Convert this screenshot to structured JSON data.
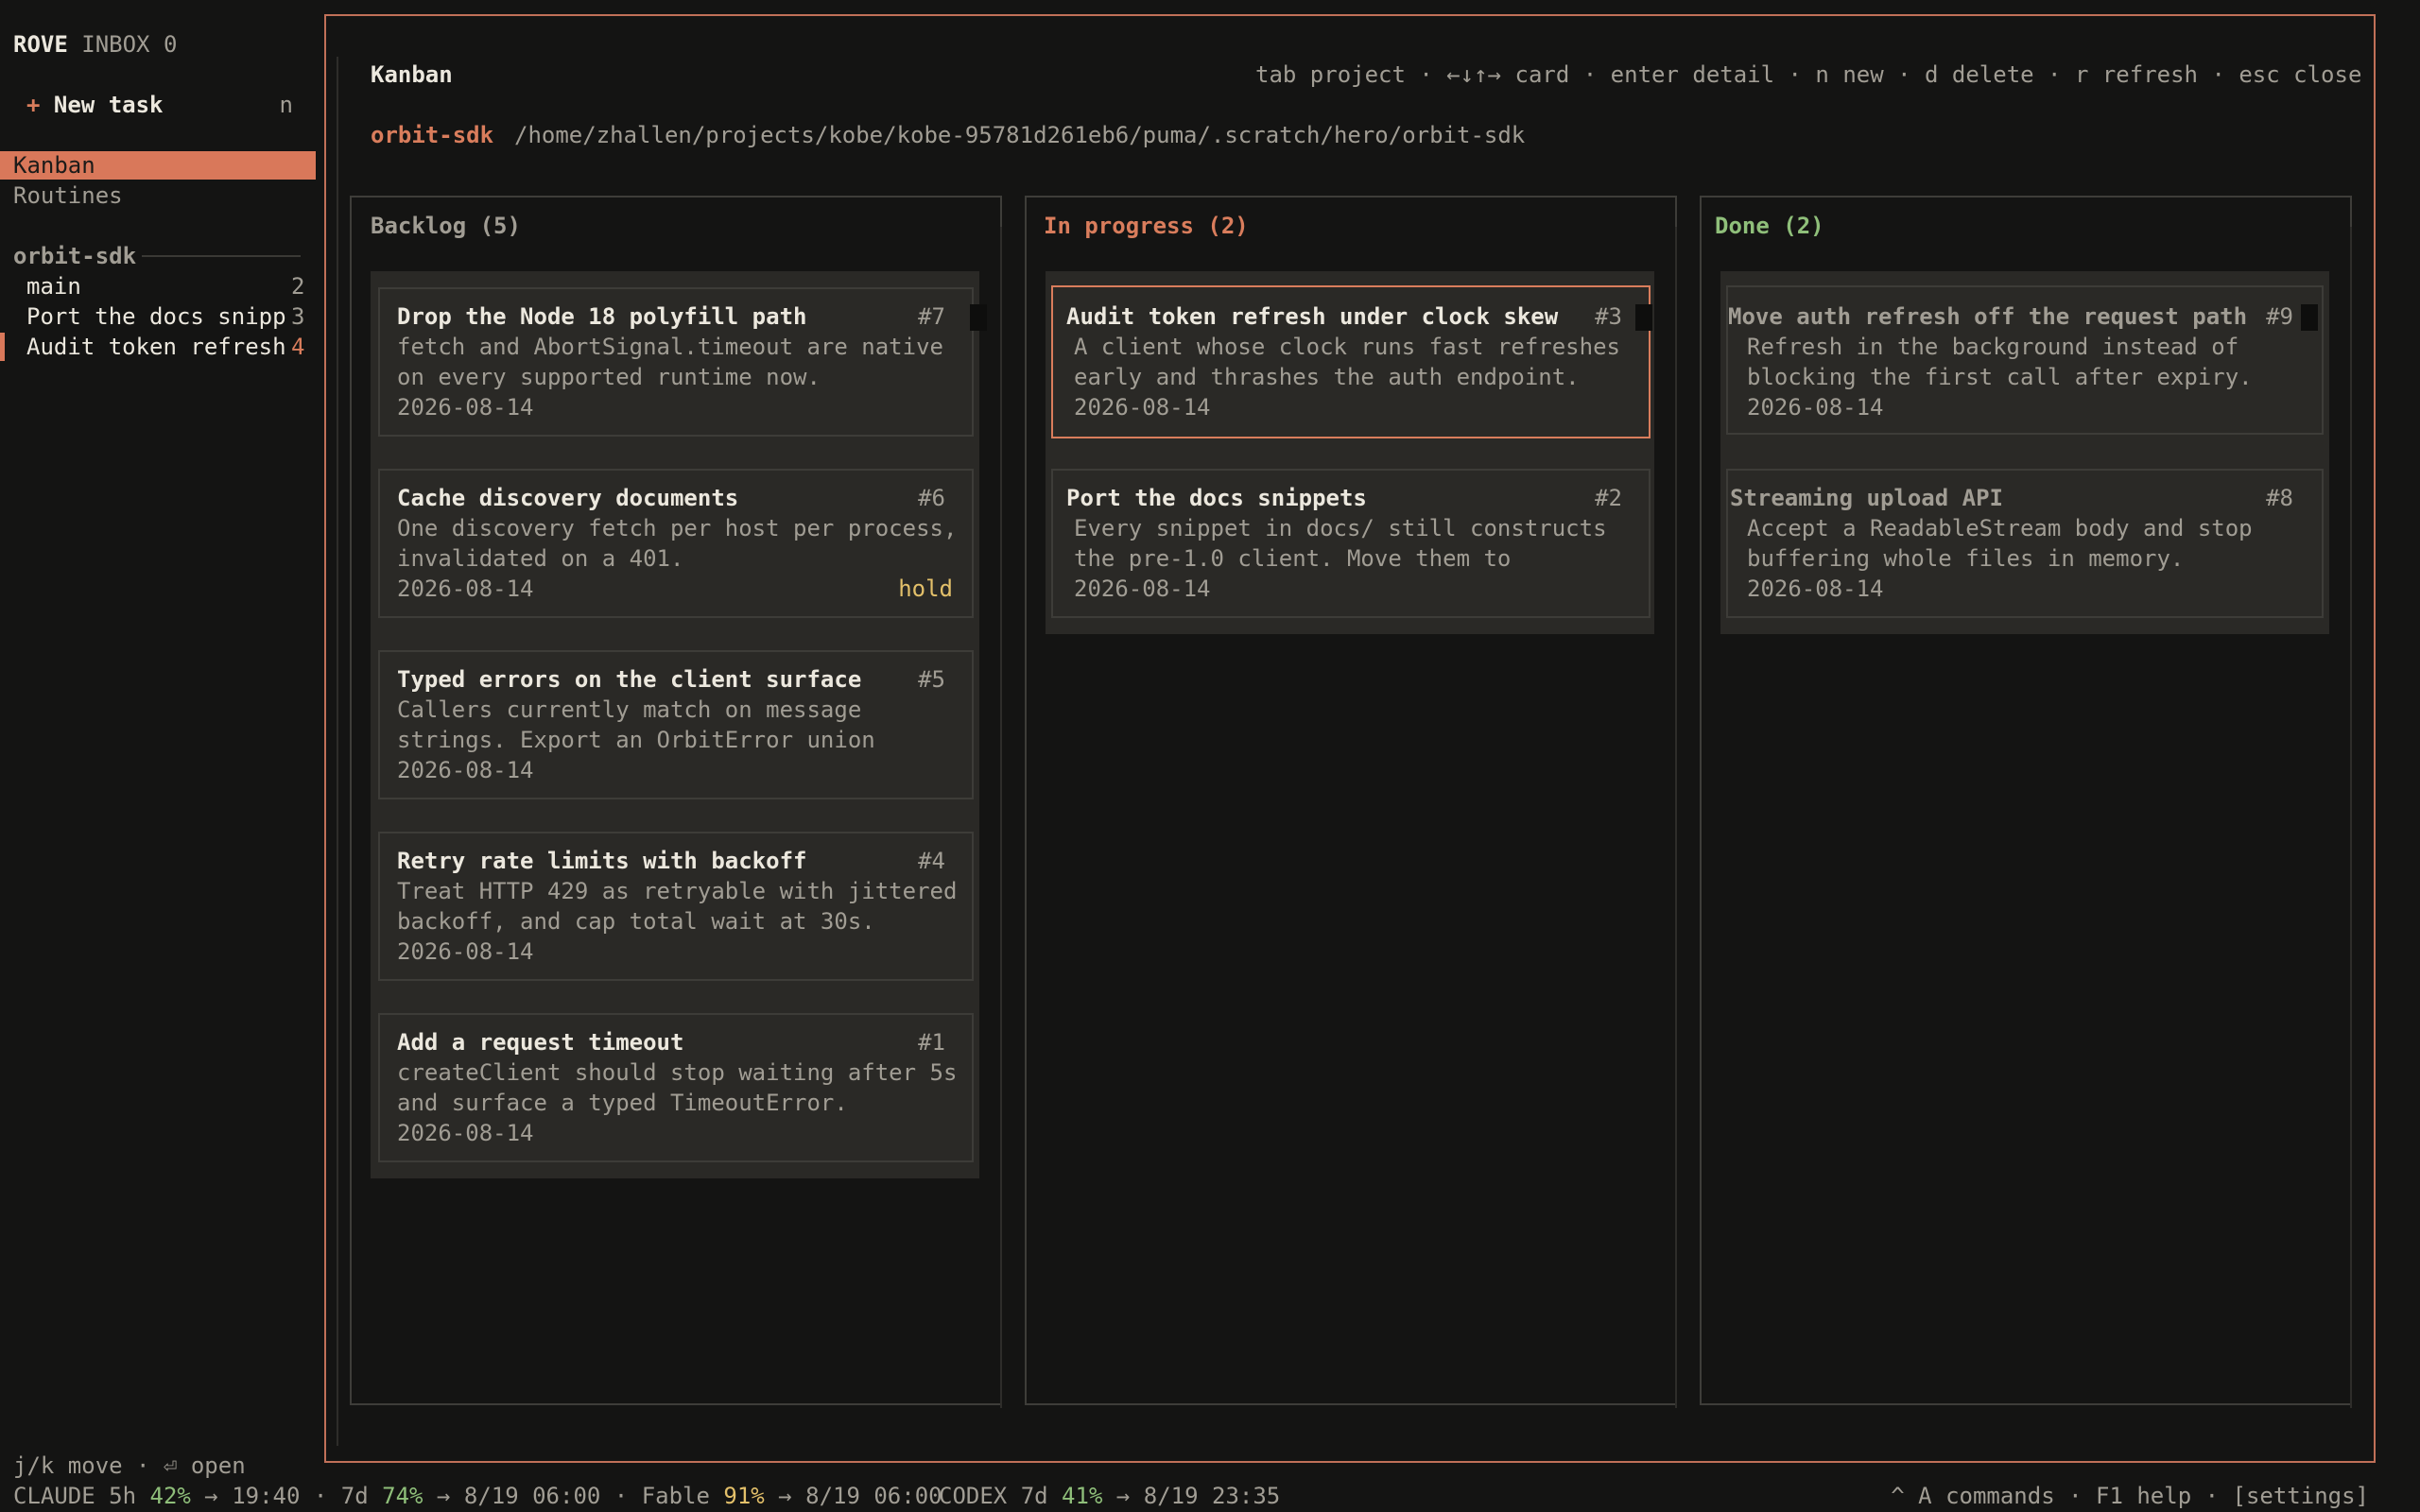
{
  "app": {
    "name": "ROVE",
    "inbox": "INBOX 0"
  },
  "sidebar": {
    "new_task": {
      "plus": "+",
      "label": "New task",
      "key": "n"
    },
    "nav": [
      {
        "label": "Kanban",
        "selected": true
      },
      {
        "label": "Routines",
        "selected": false
      }
    ],
    "project": "orbit-sdk",
    "sessions": [
      {
        "label": "main",
        "count": "2"
      },
      {
        "label": "Port the docs snipp",
        "count": "3"
      },
      {
        "label": "Audit token refresh",
        "count": "4",
        "active": true
      }
    ],
    "footer": "j/k move · ⏎ open"
  },
  "header": {
    "title": "Kanban",
    "hints": "tab project · ←↓↑→ card · enter detail · n new · d delete · r refresh · esc close",
    "project": "orbit-sdk",
    "path": "/home/zhallen/projects/kobe/kobe-95781d261eb6/puma/.scratch/hero/orbit-sdk"
  },
  "columns": [
    {
      "title": "Backlog (5)",
      "cards": [
        {
          "title": "Drop the Node 18 polyfill path",
          "id": "#7",
          "lines": [
            "fetch and AbortSignal.timeout are native",
            "on every supported runtime now."
          ],
          "date": "2026-08-14"
        },
        {
          "title": "Cache discovery documents",
          "id": "#6",
          "lines": [
            "One discovery fetch per host per process,",
            "invalidated on a 401."
          ],
          "date": "2026-08-14",
          "badge": "hold"
        },
        {
          "title": "Typed errors on the client surface",
          "id": "#5",
          "lines": [
            "Callers currently match on message",
            "strings. Export an OrbitError union"
          ],
          "date": "2026-08-14"
        },
        {
          "title": "Retry rate limits with backoff",
          "id": "#4",
          "lines": [
            "Treat HTTP 429 as retryable with jittered",
            "backoff, and cap total wait at 30s."
          ],
          "date": "2026-08-14"
        },
        {
          "title": "Add a request timeout",
          "id": "#1",
          "lines": [
            "createClient should stop waiting after 5s",
            "and surface a typed TimeoutError."
          ],
          "date": "2026-08-14"
        }
      ]
    },
    {
      "title": "In progress (2)",
      "cards": [
        {
          "title": "Audit token refresh under clock skew",
          "id": "#3",
          "lines": [
            "A client whose clock runs fast refreshes",
            "early and thrashes the auth endpoint."
          ],
          "date": "2026-08-14",
          "active": true
        },
        {
          "title": "Port the docs snippets",
          "id": "#2",
          "lines": [
            "Every snippet in docs/ still constructs",
            "the pre-1.0 client. Move them to"
          ],
          "date": "2026-08-14"
        }
      ]
    },
    {
      "title": "Done (2)",
      "cards": [
        {
          "title": "Move auth refresh off the request path",
          "id": "#9",
          "lines": [
            "Refresh in the background instead of",
            "blocking the first call after expiry."
          ],
          "date": "2026-08-14"
        },
        {
          "title": "Streaming upload API",
          "id": "#8",
          "lines": [
            "Accept a ReadableStream body and stop",
            "buffering whole files in memory."
          ],
          "date": "2026-08-14"
        }
      ]
    }
  ],
  "status": {
    "claude_label": "CLAUDE 5h ",
    "claude_5h_pct": "42%",
    "claude_5h_reset": " → 19:40 · 7d ",
    "claude_7d_pct": "74%",
    "claude_7d_reset": " → 8/19 06:00 · Fable ",
    "fable_pct": "91%",
    "fable_reset": " → 8/19 06:00",
    "codex_label": "CODEX 7d ",
    "codex_pct": "41%",
    "codex_reset": " → 8/19 23:35",
    "right": "^ A commands · F1 help · [settings]"
  },
  "colors": {
    "accent": "#d97d5c",
    "green": "#8fbf7a",
    "yellow": "#e3c06a"
  }
}
